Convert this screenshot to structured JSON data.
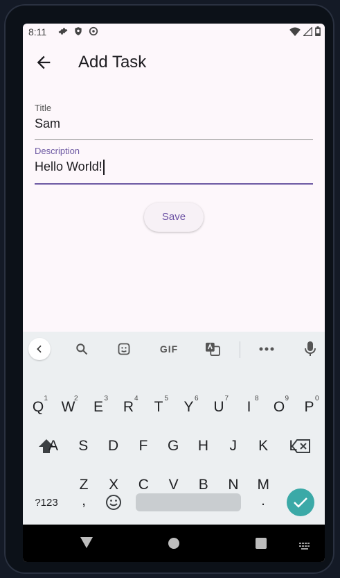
{
  "status": {
    "time": "8:11"
  },
  "appbar": {
    "title": "Add Task"
  },
  "form": {
    "title_label": "Title",
    "title_value": "Sam",
    "description_label": "Description",
    "description_value": "Hello World!",
    "save_label": "Save"
  },
  "keyboard": {
    "row1": [
      {
        "key": "Q",
        "hint": "1"
      },
      {
        "key": "W",
        "hint": "2"
      },
      {
        "key": "E",
        "hint": "3"
      },
      {
        "key": "R",
        "hint": "4"
      },
      {
        "key": "T",
        "hint": "5"
      },
      {
        "key": "Y",
        "hint": "6"
      },
      {
        "key": "U",
        "hint": "7"
      },
      {
        "key": "I",
        "hint": "8"
      },
      {
        "key": "O",
        "hint": "9"
      },
      {
        "key": "P",
        "hint": "0"
      }
    ],
    "row2": [
      "A",
      "S",
      "D",
      "F",
      "G",
      "H",
      "J",
      "K",
      "L"
    ],
    "row3": [
      "Z",
      "X",
      "C",
      "V",
      "B",
      "N",
      "M"
    ],
    "symbols_label": "?123",
    "comma": ",",
    "period": ".",
    "gif_label": "GIF"
  },
  "colors": {
    "accent": "#6d59a3",
    "enter": "#3ba9a7",
    "screen_bg": "#fdf7fb",
    "keyboard_bg": "#eceff1"
  }
}
